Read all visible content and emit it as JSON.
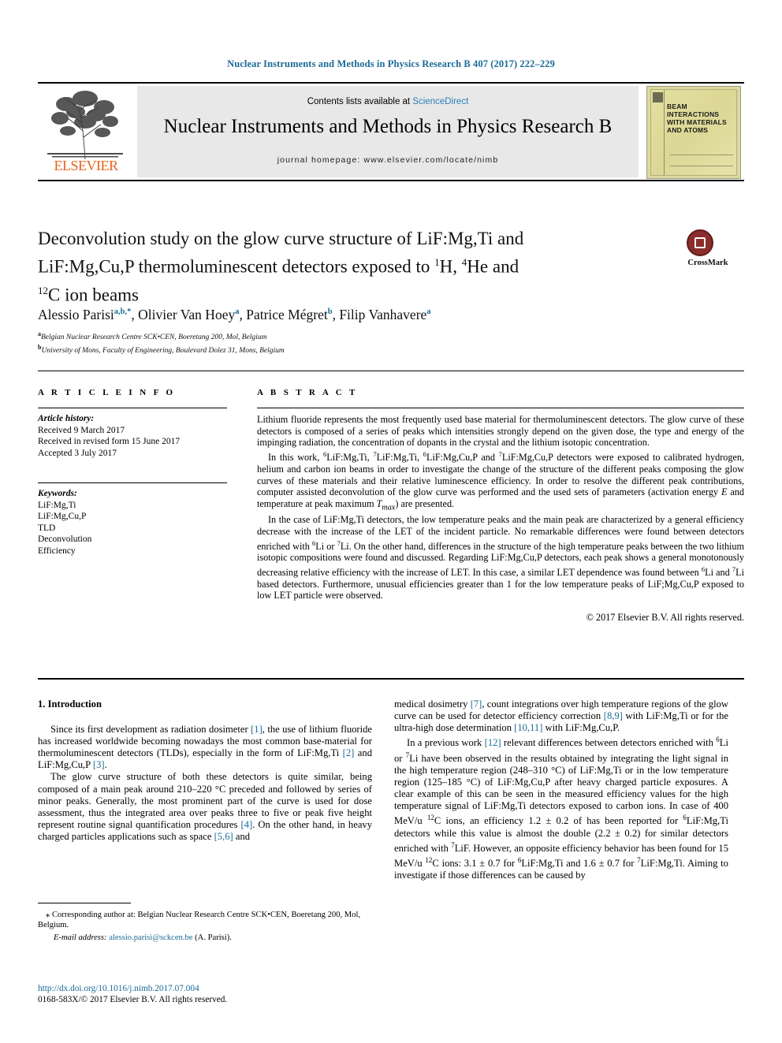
{
  "running_head": "Nuclear Instruments and Methods in Physics Research B 407 (2017) 222–229",
  "masthead": {
    "publisher": "ELSEVIER",
    "contents_prefix": "Contents lists available at ",
    "contents_link": "ScienceDirect",
    "journal_name": "Nuclear Instruments and Methods in Physics Research B",
    "homepage": "journal homepage: www.elsevier.com/locate/nimb",
    "cover_title": "BEAM INTERACTIONS WITH MATERIALS AND ATOMS"
  },
  "crossmark": {
    "label": "CrossMark"
  },
  "title": {
    "line1": "Deconvolution study on the glow curve structure of LiF:Mg,Ti and",
    "line2_a": "LiF:Mg,Cu,P thermoluminescent detectors exposed to ",
    "line2_sup1": "1",
    "line2_b": "H, ",
    "line2_sup2": "4",
    "line2_c": "He and",
    "line3_sup": "12",
    "line3": "C ion beams"
  },
  "authors": {
    "list": [
      {
        "name": "Alessio Parisi",
        "marks": "a,b,*"
      },
      {
        "name": "Olivier Van Hoey",
        "marks": "a"
      },
      {
        "name": "Patrice Mégret",
        "marks": "b"
      },
      {
        "name": "Filip Vanhavere",
        "marks": "a"
      }
    ]
  },
  "affiliations": [
    {
      "mark": "a",
      "text": "Belgian Nuclear Research Centre SCK•CEN, Boeretang 200, Mol, Belgium"
    },
    {
      "mark": "b",
      "text": "University of Mons, Faculty of Engineering, Boulevard Dolez 31, Mons, Belgium"
    }
  ],
  "article_info": {
    "heading": "A R T I C L E   I N F O",
    "history_label": "Article history:",
    "history": [
      "Received 9 March 2017",
      "Received in revised form 15 June 2017",
      "Accepted 3 July 2017"
    ],
    "keywords_label": "Keywords:",
    "keywords": [
      "LiF:Mg,Ti",
      "LiF:Mg,Cu,P",
      "TLD",
      "Deconvolution",
      "Efficiency"
    ]
  },
  "abstract": {
    "heading": "A B S T R A C T",
    "paragraphs": [
      "Lithium fluoride represents the most frequently used base material for thermoluminescent detectors. The glow curve of these detectors is composed of a series of peaks which intensities strongly depend on the given dose, the type and energy of the impinging radiation, the concentration of dopants in the crystal and the lithium isotopic concentration.",
      "In this work, <sup>6</sup>LiF:Mg,Ti, <sup>7</sup>LiF:Mg,Ti, <sup>6</sup>LiF:Mg,Cu,P and <sup>7</sup>LiF:Mg,Cu,P detectors were exposed to calibrated hydrogen, helium and carbon ion beams in order to investigate the change of the structure of the different peaks composing the glow curves of these materials and their relative luminescence efficiency. In order to resolve the different peak contributions, computer assisted deconvolution of the glow curve was performed and the used sets of parameters (activation energy <span class=\"it\">E</span> and temperature at peak maximum <span class=\"it\">T<sub>max</sub></span>) are presented.",
      "In the case of LiF:Mg,Ti detectors, the low temperature peaks and the main peak are characterized by a general efficiency decrease with the increase of the LET of the incident particle. No remarkable differences were found between detectors enriched with <sup>6</sup>Li or <sup>7</sup>Li. On the other hand, differences in the structure of the high temperature peaks between the two lithium isotopic compositions were found and discussed. Regarding LiF:Mg,Cu,P detectors, each peak shows a general monotonously decreasing relative efficiency with the increase of LET. In this case, a similar LET dependence was found between <sup>6</sup>Li and <sup>7</sup>Li based detectors. Furthermore, unusual efficiencies greater than 1 for the low temperature peaks of LiF;Mg,Cu,P exposed to low LET particle were observed."
    ],
    "copyright": "© 2017 Elsevier B.V. All rights reserved."
  },
  "section": {
    "number_title": "1. Introduction"
  },
  "body_left": [
    "Since its first development as radiation dosimeter <span class=\"ref\">[1]</span>, the use of lithium fluoride has increased worldwide becoming nowadays the most common base-material for thermoluminescent detectors (TLDs), especially in the form of LiF:Mg,Ti <span class=\"ref\">[2]</span> and LiF:Mg,Cu,P <span class=\"ref\">[3]</span>.",
    "The glow curve structure of both these detectors is quite similar, being composed of a main peak around 210–220 °C preceded and followed by series of minor peaks. Generally, the most prominent part of the curve is used for dose assessment, thus the integrated area over peaks three to five or peak five height represent routine signal quantification procedures <span class=\"ref\">[4]</span>. On the other hand, in heavy charged particles applications such as space <span class=\"ref\">[5,6]</span> and"
  ],
  "body_right": [
    "medical dosimetry <span class=\"ref\">[7]</span>, count integrations over high temperature regions of the glow curve can be used for detector efficiency correction <span class=\"ref\">[8,9]</span> with LiF:Mg,Ti or for the ultra-high dose determination <span class=\"ref\">[10,11]</span> with LiF:Mg,Cu,P.",
    "In a previous work <span class=\"ref\">[12]</span> relevant differences between detectors enriched with <sup>6</sup>Li or <sup>7</sup>Li have been observed in the results obtained by integrating the light signal in the high temperature region (248–310 °C) of LiF:Mg,Ti or in the low temperature region (125–185 °C) of LiF:Mg,Cu,P after heavy charged particle exposures. A clear example of this can be seen in the measured efficiency values for the high temperature signal of LiF:Mg,Ti detectors exposed to carbon ions. In case of 400 MeV/u <sup>12</sup>C ions, an efficiency 1.2 ± 0.2 of has been reported for <sup>6</sup>LiF:Mg,Ti detectors while this value is almost the double (2.2 ± 0.2) for similar detectors enriched with <sup>7</sup>LiF. However, an opposite efficiency behavior has been found for 15 MeV/u <sup>12</sup>C ions: 3.1 ± 0.7 for <sup>6</sup>LiF:Mg,Ti and 1.6 ± 0.7 for <sup>7</sup>LiF:Mg,Ti. Aiming to investigate if those differences can be caused by"
  ],
  "footnote": {
    "corresponding": "⁎ Corresponding author at: Belgian Nuclear Research Centre SCK•CEN, Boeretang 200, Mol, Belgium.",
    "email_label": "E-mail address:",
    "email": "alessio.parisi@sckcen.be",
    "email_suffix": "(A. Parisi)."
  },
  "footer": {
    "doi": "http://dx.doi.org/10.1016/j.nimb.2017.07.004",
    "issn": "0168-583X/© 2017 Elsevier B.V. All rights reserved."
  },
  "colors": {
    "link": "#1a6b96",
    "elsevier_orange": "#e8641a",
    "banner_grey": "#e8e8e8",
    "crossmark_red": "#8b2d2d"
  }
}
